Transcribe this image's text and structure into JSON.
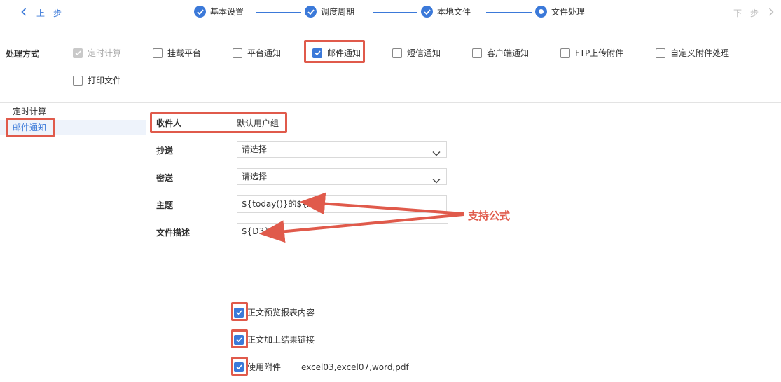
{
  "nav": {
    "back_label": "上一步",
    "next_label": "下一步"
  },
  "steps": [
    {
      "label": "基本设置",
      "state": "done"
    },
    {
      "label": "调度周期",
      "state": "done"
    },
    {
      "label": "本地文件",
      "state": "done"
    },
    {
      "label": "文件处理",
      "state": "current"
    }
  ],
  "methods": {
    "label": "处理方式",
    "options": [
      {
        "label": "定时计算",
        "checked": true,
        "disabled": true
      },
      {
        "label": "挂载平台",
        "checked": false
      },
      {
        "label": "平台通知",
        "checked": false
      },
      {
        "label": "邮件通知",
        "checked": true
      },
      {
        "label": "短信通知",
        "checked": false
      },
      {
        "label": "客户端通知",
        "checked": false
      },
      {
        "label": "FTP上传附件",
        "checked": false
      },
      {
        "label": "自定义附件处理",
        "checked": false
      },
      {
        "label": "打印文件",
        "checked": false
      }
    ]
  },
  "sidebar": {
    "items": [
      {
        "label": "定时计算",
        "active": false
      },
      {
        "label": "邮件通知",
        "active": true
      }
    ]
  },
  "form": {
    "recipient": {
      "label": "收件人",
      "value": "默认用户组"
    },
    "cc": {
      "label": "抄送",
      "value": "请选择"
    },
    "bcc": {
      "label": "密送",
      "value": "请选择"
    },
    "subject": {
      "label": "主题",
      "value": "${today()}的${A1}"
    },
    "description": {
      "label": "文件描述",
      "value": "${D3}"
    },
    "options": [
      {
        "label": "正文预览报表内容",
        "checked": true
      },
      {
        "label": "正文加上结果链接",
        "checked": true
      },
      {
        "label": "使用附件",
        "checked": true,
        "extra": "excel03,excel07,word,pdf"
      }
    ]
  },
  "annotation": {
    "text": "支持公式"
  },
  "colors": {
    "accent": "#3b79d9",
    "highlight": "#e05a4b"
  }
}
